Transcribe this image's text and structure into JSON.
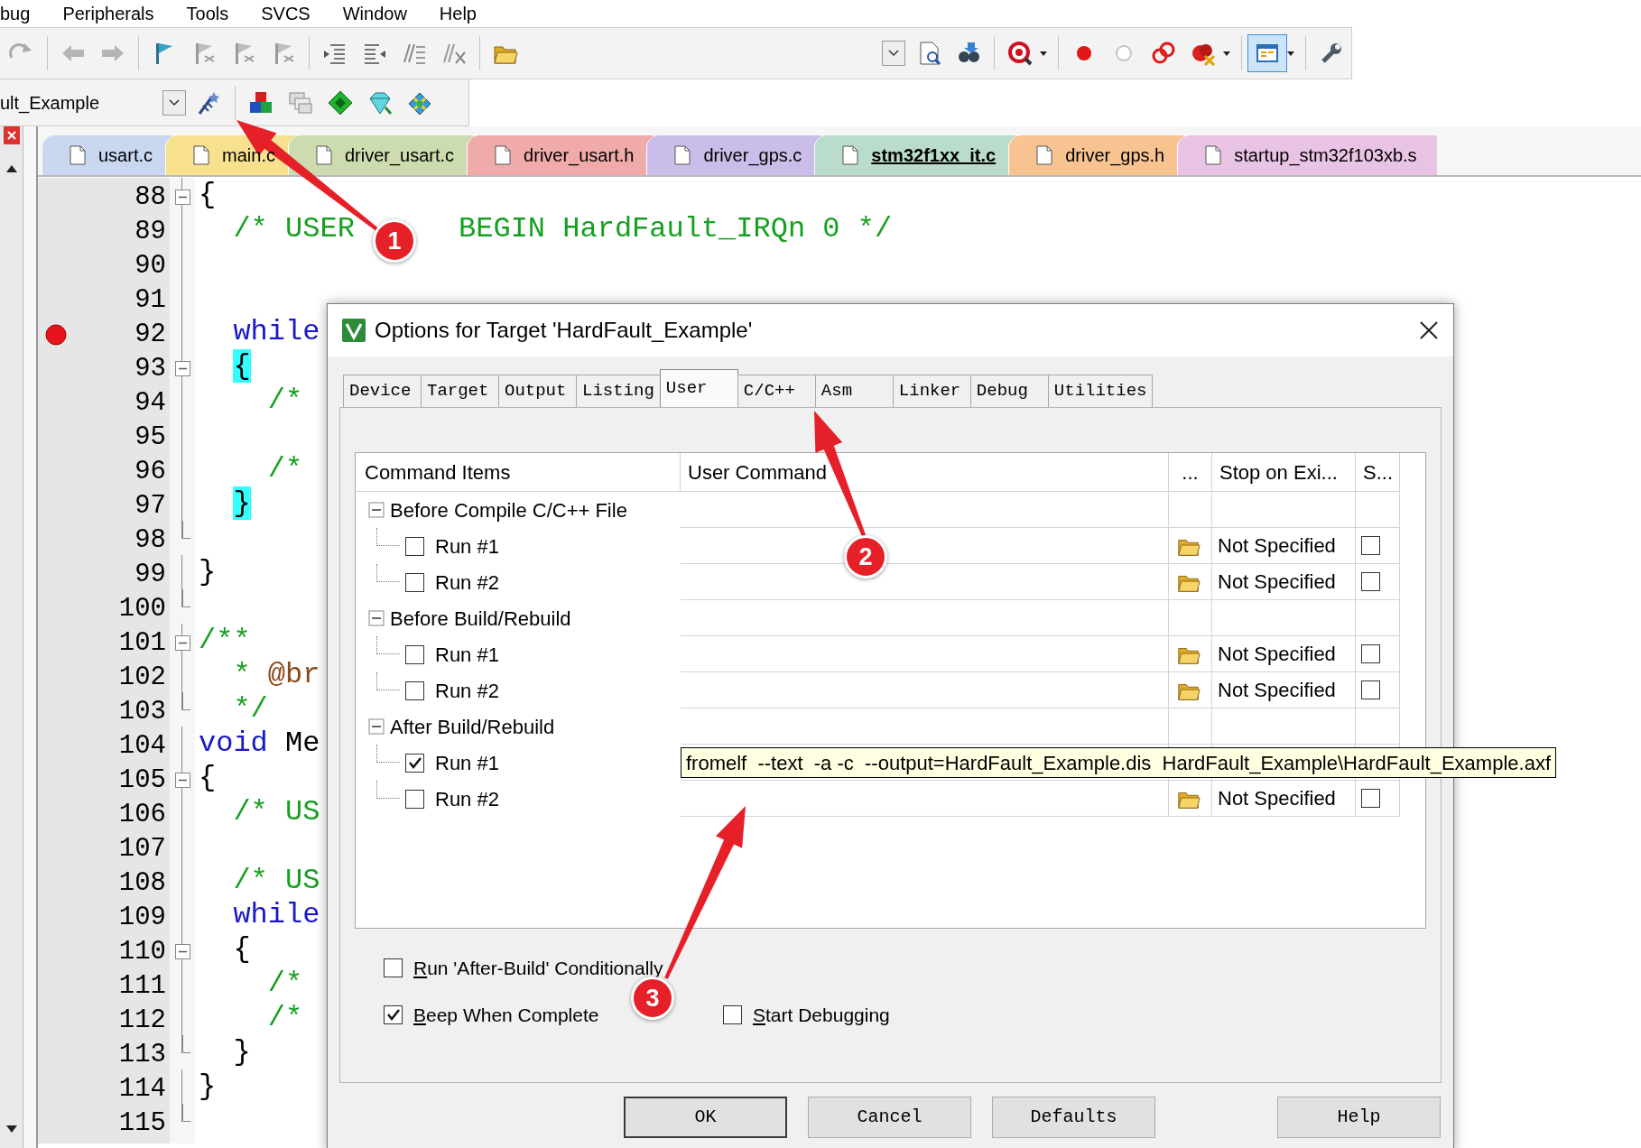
{
  "menu": [
    {
      "label": "bug"
    },
    {
      "label": "Peripherals"
    },
    {
      "label": "Tools"
    },
    {
      "label": "SVCS"
    },
    {
      "label": "Window"
    },
    {
      "label": "Help"
    }
  ],
  "target_combo": {
    "value": "ult_Example"
  },
  "file_tabs": [
    {
      "label": "usart.c",
      "color": "#c9d8f0",
      "selected": false
    },
    {
      "label": "main.c",
      "color": "#f7e08e",
      "selected": false
    },
    {
      "label": "driver_usart.c",
      "color": "#cddcae",
      "selected": false
    },
    {
      "label": "driver_usart.h",
      "color": "#f0aaaa",
      "selected": false
    },
    {
      "label": "driver_gps.c",
      "color": "#cbbde9",
      "selected": false
    },
    {
      "label": "stm32f1xx_it.c",
      "color": "#b9dccb",
      "selected": true
    },
    {
      "label": "driver_gps.h",
      "color": "#f7c391",
      "selected": false
    },
    {
      "label": "startup_stm32f103xb.s",
      "color": "#e9c3e3",
      "selected": false
    }
  ],
  "editor": {
    "lines": [
      {
        "number": "88",
        "fold_start": true,
        "fold_end": false,
        "breakpoint": false,
        "tokens": [
          {
            "text": "{",
            "kind": "plain"
          }
        ]
      },
      {
        "number": "89",
        "fold_start": false,
        "fold_end": false,
        "breakpoint": false,
        "tokens": [
          {
            "text": "  /* USER",
            "kind": "comment"
          },
          {
            "text": "      BEGIN HardFault_IRQn 0 */",
            "kind": "comment"
          }
        ]
      },
      {
        "number": "90",
        "fold_start": false,
        "fold_end": false,
        "breakpoint": false
      },
      {
        "number": "91",
        "fold_start": false,
        "fold_end": false,
        "breakpoint": false
      },
      {
        "number": "92",
        "fold_start": false,
        "fold_end": false,
        "breakpoint": true,
        "tokens": [
          {
            "text": "  while",
            "kind": "keyword"
          }
        ]
      },
      {
        "number": "93",
        "fold_start": true,
        "fold_end": false,
        "breakpoint": false,
        "tokens": [
          {
            "text": "  {",
            "kind": "match"
          }
        ]
      },
      {
        "number": "94",
        "fold_start": false,
        "fold_end": false,
        "breakpoint": false,
        "tokens": [
          {
            "text": "    /*",
            "kind": "comment"
          }
        ]
      },
      {
        "number": "95",
        "fold_start": false,
        "fold_end": false,
        "breakpoint": false
      },
      {
        "number": "96",
        "fold_start": false,
        "fold_end": false,
        "breakpoint": false,
        "tokens": [
          {
            "text": "    /*",
            "kind": "comment"
          }
        ]
      },
      {
        "number": "97",
        "fold_start": false,
        "fold_end": false,
        "breakpoint": false,
        "tokens": [
          {
            "text": "  }",
            "kind": "match"
          }
        ]
      },
      {
        "number": "98",
        "fold_start": false,
        "fold_end": true,
        "breakpoint": false
      },
      {
        "number": "99",
        "fold_start": false,
        "fold_end": false,
        "breakpoint": false,
        "tokens": [
          {
            "text": "}",
            "kind": "plain"
          }
        ]
      },
      {
        "number": "100",
        "fold_start": false,
        "fold_end": true,
        "breakpoint": false
      },
      {
        "number": "101",
        "fold_start": true,
        "fold_end": false,
        "breakpoint": false,
        "tokens": [
          {
            "text": "/**",
            "kind": "comment"
          }
        ]
      },
      {
        "number": "102",
        "fold_start": false,
        "fold_end": false,
        "breakpoint": false,
        "tokens": [
          {
            "text": "  *",
            "kind": "comment"
          },
          {
            "text": " @br",
            "kind": "doctag"
          }
        ]
      },
      {
        "number": "103",
        "fold_start": false,
        "fold_end": true,
        "breakpoint": false,
        "tokens": [
          {
            "text": "  */",
            "kind": "comment"
          }
        ]
      },
      {
        "number": "104",
        "fold_start": false,
        "fold_end": false,
        "breakpoint": false,
        "tokens": [
          {
            "text": "void",
            "kind": "keyword"
          },
          {
            "text": " Me",
            "kind": "plain"
          }
        ]
      },
      {
        "number": "105",
        "fold_start": true,
        "fold_end": false,
        "breakpoint": false,
        "tokens": [
          {
            "text": "{",
            "kind": "plain"
          }
        ]
      },
      {
        "number": "106",
        "fold_start": false,
        "fold_end": false,
        "breakpoint": false,
        "tokens": [
          {
            "text": "  /* US",
            "kind": "comment"
          }
        ]
      },
      {
        "number": "107",
        "fold_start": false,
        "fold_end": false,
        "breakpoint": false
      },
      {
        "number": "108",
        "fold_start": false,
        "fold_end": false,
        "breakpoint": false,
        "tokens": [
          {
            "text": "  /* US",
            "kind": "comment"
          }
        ]
      },
      {
        "number": "109",
        "fold_start": false,
        "fold_end": false,
        "breakpoint": false,
        "tokens": [
          {
            "text": "  while",
            "kind": "keyword"
          }
        ]
      },
      {
        "number": "110",
        "fold_start": true,
        "fold_end": false,
        "breakpoint": false,
        "tokens": [
          {
            "text": "  {",
            "kind": "plain"
          }
        ]
      },
      {
        "number": "111",
        "fold_start": false,
        "fold_end": false,
        "breakpoint": false,
        "tokens": [
          {
            "text": "    /*",
            "kind": "comment"
          }
        ]
      },
      {
        "number": "112",
        "fold_start": false,
        "fold_end": false,
        "breakpoint": false,
        "tokens": [
          {
            "text": "    /*",
            "kind": "comment"
          }
        ]
      },
      {
        "number": "113",
        "fold_start": false,
        "fold_end": true,
        "breakpoint": false,
        "tokens": [
          {
            "text": "  }",
            "kind": "plain"
          }
        ]
      },
      {
        "number": "114",
        "fold_start": false,
        "fold_end": false,
        "breakpoint": false,
        "tokens": [
          {
            "text": "}",
            "kind": "plain"
          }
        ]
      },
      {
        "number": "115",
        "fold_start": false,
        "fold_end": true,
        "breakpoint": false
      }
    ]
  },
  "dialog": {
    "title": "Options for Target 'HardFault_Example'",
    "tabs": [
      {
        "label": "Device",
        "selected": false
      },
      {
        "label": "Target",
        "selected": false
      },
      {
        "label": "Output",
        "selected": false
      },
      {
        "label": "Listing",
        "selected": false
      },
      {
        "label": "User",
        "selected": true
      },
      {
        "label": "C/C++",
        "selected": false
      },
      {
        "label": "Asm",
        "selected": false
      },
      {
        "label": "Linker",
        "selected": false
      },
      {
        "label": "Debug",
        "selected": false
      },
      {
        "label": "Utilities",
        "selected": false
      }
    ],
    "table": {
      "columns": [
        "Command Items",
        "User Command",
        "...",
        "Stop on Exi...",
        "S..."
      ],
      "groups": [
        {
          "label": "Before Compile C/C++ File",
          "expanded": true,
          "children": [
            {
              "label": "Run #1",
              "checked": false,
              "stop_on_exit": "Not Specified",
              "stop_checked": false
            },
            {
              "label": "Run #2",
              "checked": false,
              "stop_on_exit": "Not Specified",
              "stop_checked": false
            }
          ]
        },
        {
          "label": "Before Build/Rebuild",
          "expanded": true,
          "children": [
            {
              "label": "Run #1",
              "checked": false,
              "stop_on_exit": "Not Specified",
              "stop_checked": false
            },
            {
              "label": "Run #2",
              "checked": false,
              "stop_on_exit": "Not Specified",
              "stop_checked": false
            }
          ]
        },
        {
          "label": "After Build/Rebuild",
          "expanded": true,
          "children": [
            {
              "label": "Run #1",
              "checked": true,
              "user_command": "fromelf  --text  -a -c  --output=HardFault_Example.dis  HardFault_Example\\HardFault_Example.axf"
            },
            {
              "label": "Run #2",
              "checked": false,
              "stop_on_exit": "Not Specified",
              "stop_checked": false
            }
          ]
        }
      ]
    },
    "options": [
      {
        "label": "Run 'After-Build' Conditionally",
        "checked": false
      },
      {
        "label": "Beep When Complete",
        "checked": true
      },
      {
        "label": "Start Debugging",
        "checked": false
      }
    ],
    "buttons": [
      "OK",
      "Cancel",
      "Defaults",
      "Help"
    ]
  },
  "annotations": [
    {
      "number": "1"
    },
    {
      "number": "2"
    },
    {
      "number": "3"
    }
  ]
}
